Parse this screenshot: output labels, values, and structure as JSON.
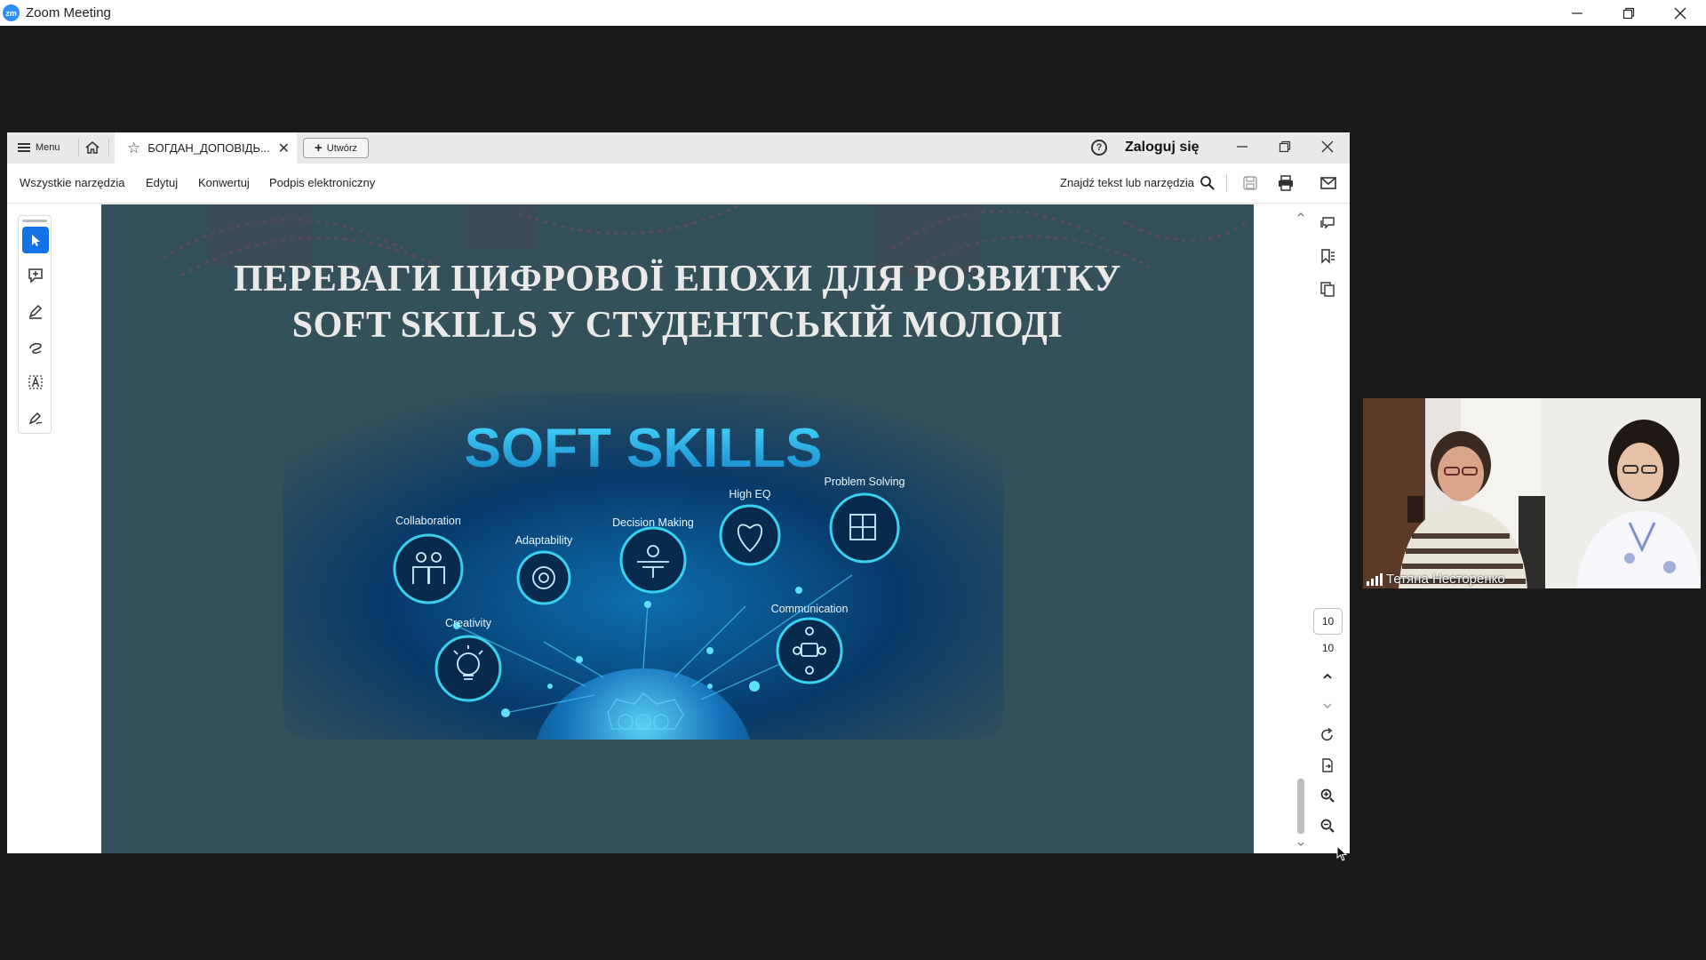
{
  "zoom": {
    "logo_text": "zm",
    "title": "Zoom Meeting"
  },
  "acrobat": {
    "menu_label": "Menu",
    "tab_label": "БОГДАН_ДОПОВІДЬ...",
    "create_label": "Utwórz",
    "login_label": "Zaloguj się",
    "tools": [
      "Wszystkie narzędzia",
      "Edytuj",
      "Konwertuj",
      "Podpis elektroniczny"
    ],
    "find_label": "Znajdź tekst lub narzędzia",
    "page_current": "10",
    "page_total": "10"
  },
  "slide": {
    "title_line1": "ПЕРЕВАГИ ЦИФРОВОЇ ЕПОХИ ДЛЯ РОЗВИТКУ",
    "title_line2": "SOFT SKILLS У СТУДЕНТСЬКІЙ МОЛОДІ",
    "image_heading": "SOFT SKILLS",
    "skills": [
      "Collaboration",
      "Adaptability",
      "Decision Making",
      "High EQ",
      "Problem Solving",
      "Creativity",
      "Communication"
    ]
  },
  "participant": {
    "name": "Тетяна Несторенко"
  },
  "colors": {
    "slide_bg": "#34505a",
    "acrobat_blue": "#1473e6",
    "zoom_blue": "#2d8cff",
    "glow": "#3ad1f0"
  }
}
